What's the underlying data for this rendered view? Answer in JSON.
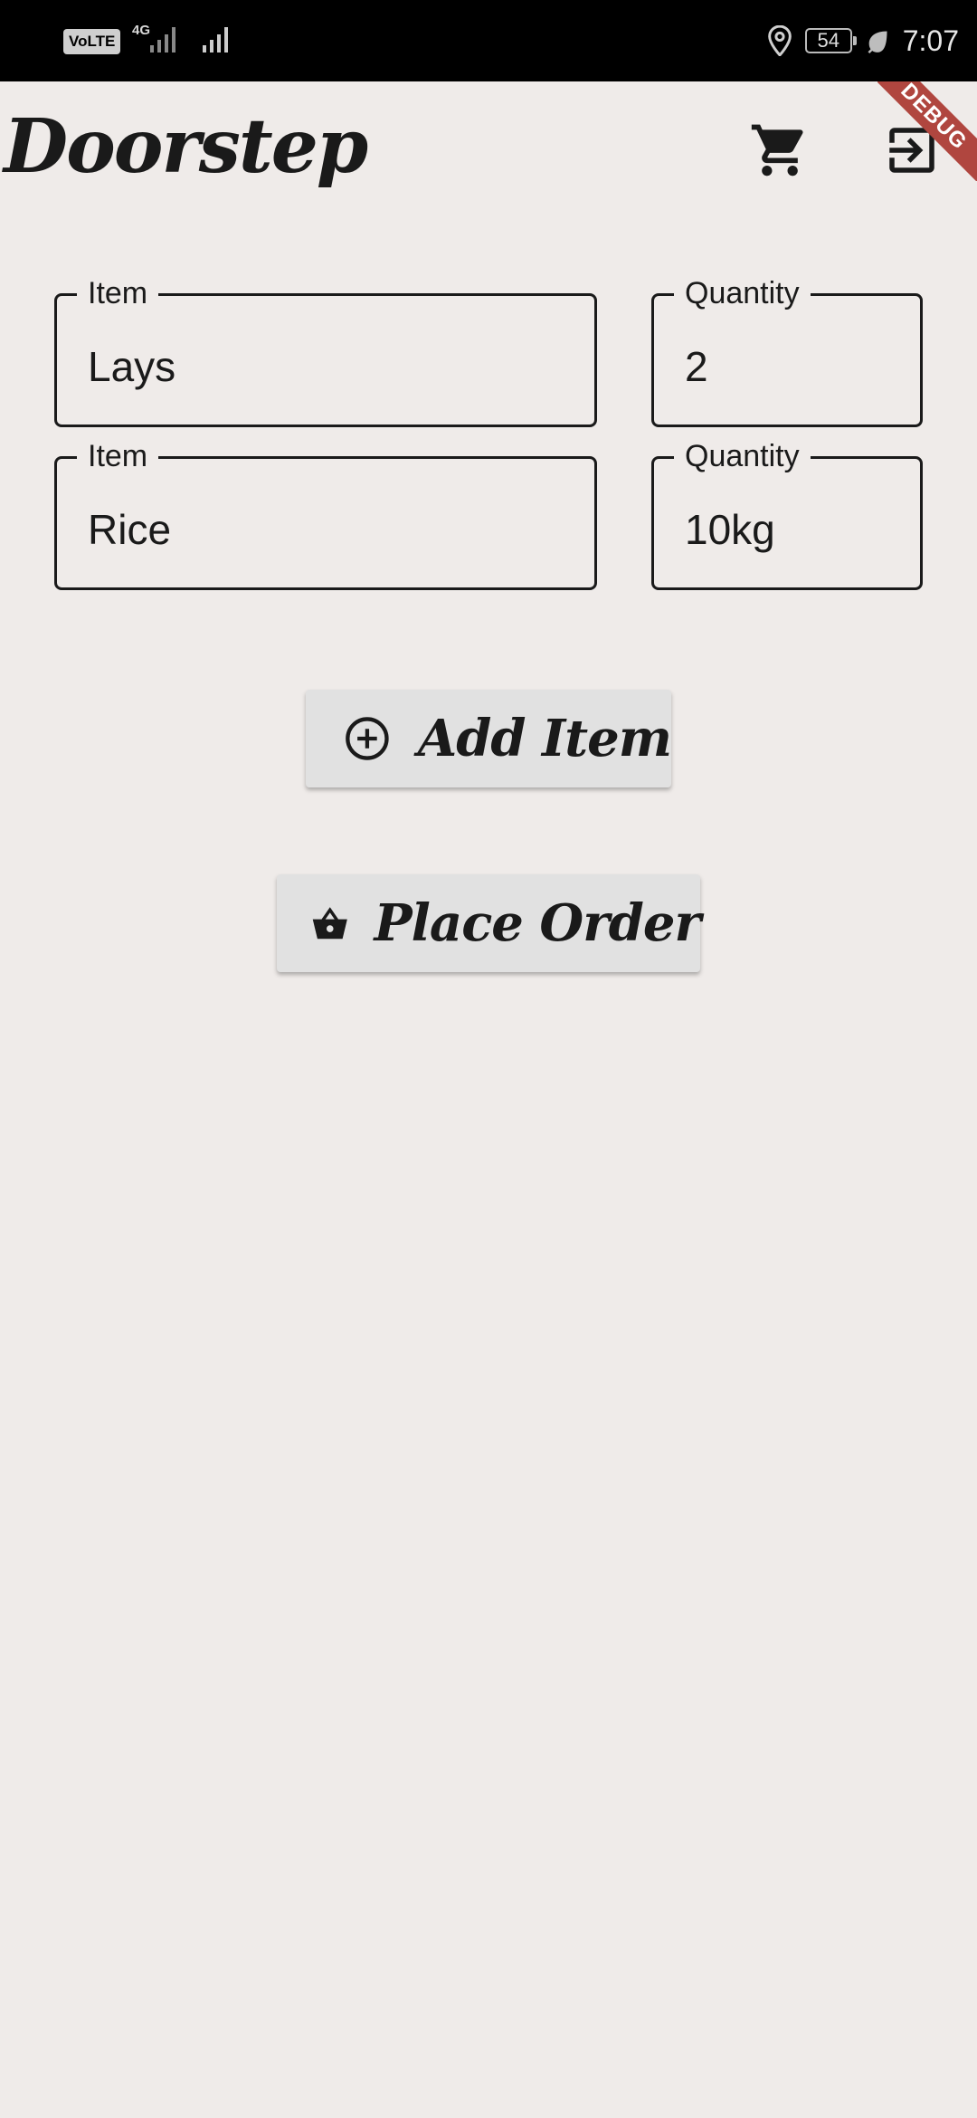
{
  "status_bar": {
    "volte": "VoLTE",
    "network": "4G",
    "battery": "54",
    "time": "7:07"
  },
  "app_bar": {
    "title": "Doorstep",
    "icons": [
      "cart-icon",
      "logout-icon"
    ],
    "debug_banner": "DEBUG"
  },
  "items": [
    {
      "item_label": "Item",
      "item_value": "Lays",
      "quantity_label": "Quantity",
      "quantity_value": "2"
    },
    {
      "item_label": "Item",
      "item_value": "Rice",
      "quantity_label": "Quantity",
      "quantity_value": "10kg"
    }
  ],
  "actions": {
    "add_item": "Add Item",
    "place_order": "Place Order"
  },
  "colors": {
    "background": "#efebe9",
    "text": "#1a1a1a",
    "button": "#e1e1e1",
    "debug_banner": "#b0463f"
  }
}
